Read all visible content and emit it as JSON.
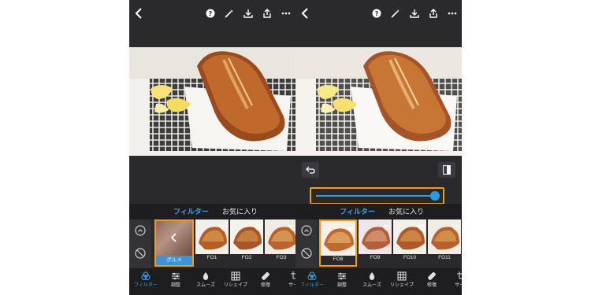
{
  "left_screen": {
    "tabs": [
      {
        "label": "フィルター",
        "active": true
      },
      {
        "label": "お気に入り",
        "active": false
      }
    ],
    "category_label": "グルメ",
    "thumbnails": [
      {
        "label": "FO1",
        "favorite": true
      },
      {
        "label": "FO2",
        "favorite": true
      },
      {
        "label": "FO3",
        "favorite": true
      }
    ],
    "tools": [
      {
        "label": "フィルター",
        "icon": "filter-icon",
        "active": true
      },
      {
        "label": "調整",
        "icon": "adjust-icon",
        "active": false
      },
      {
        "label": "スムーズ",
        "icon": "drop-icon",
        "active": false
      },
      {
        "label": "リシェイプ",
        "icon": "reshape-icon",
        "active": false
      },
      {
        "label": "修復",
        "icon": "bandage-icon",
        "active": false
      },
      {
        "label": "サイズ",
        "icon": "crop-icon",
        "active": false
      }
    ]
  },
  "right_screen": {
    "tabs": [
      {
        "label": "フィルター",
        "active": true
      },
      {
        "label": "お気に入り",
        "active": false
      }
    ],
    "slider_value": 1.0,
    "thumbnails": [
      {
        "label": "FO8",
        "favorite": true,
        "selected": true
      },
      {
        "label": "FO9",
        "favorite": true,
        "selected": false
      },
      {
        "label": "FO10",
        "favorite": true,
        "selected": false
      },
      {
        "label": "FO11",
        "favorite": true,
        "selected": false
      }
    ],
    "tools": [
      {
        "label": "フィルター",
        "icon": "filter-icon",
        "active": true
      },
      {
        "label": "調整",
        "icon": "adjust-icon",
        "active": false
      },
      {
        "label": "スムーズ",
        "icon": "drop-icon",
        "active": false
      },
      {
        "label": "リシェイプ",
        "icon": "reshape-icon",
        "active": false
      },
      {
        "label": "修復",
        "icon": "bandage-icon",
        "active": false
      },
      {
        "label": "サイズ",
        "icon": "crop-icon",
        "active": false
      }
    ]
  },
  "colors": {
    "accent": "#3da2e6",
    "highlight_border": "#f39a1e",
    "background": "#2a2a2c"
  }
}
